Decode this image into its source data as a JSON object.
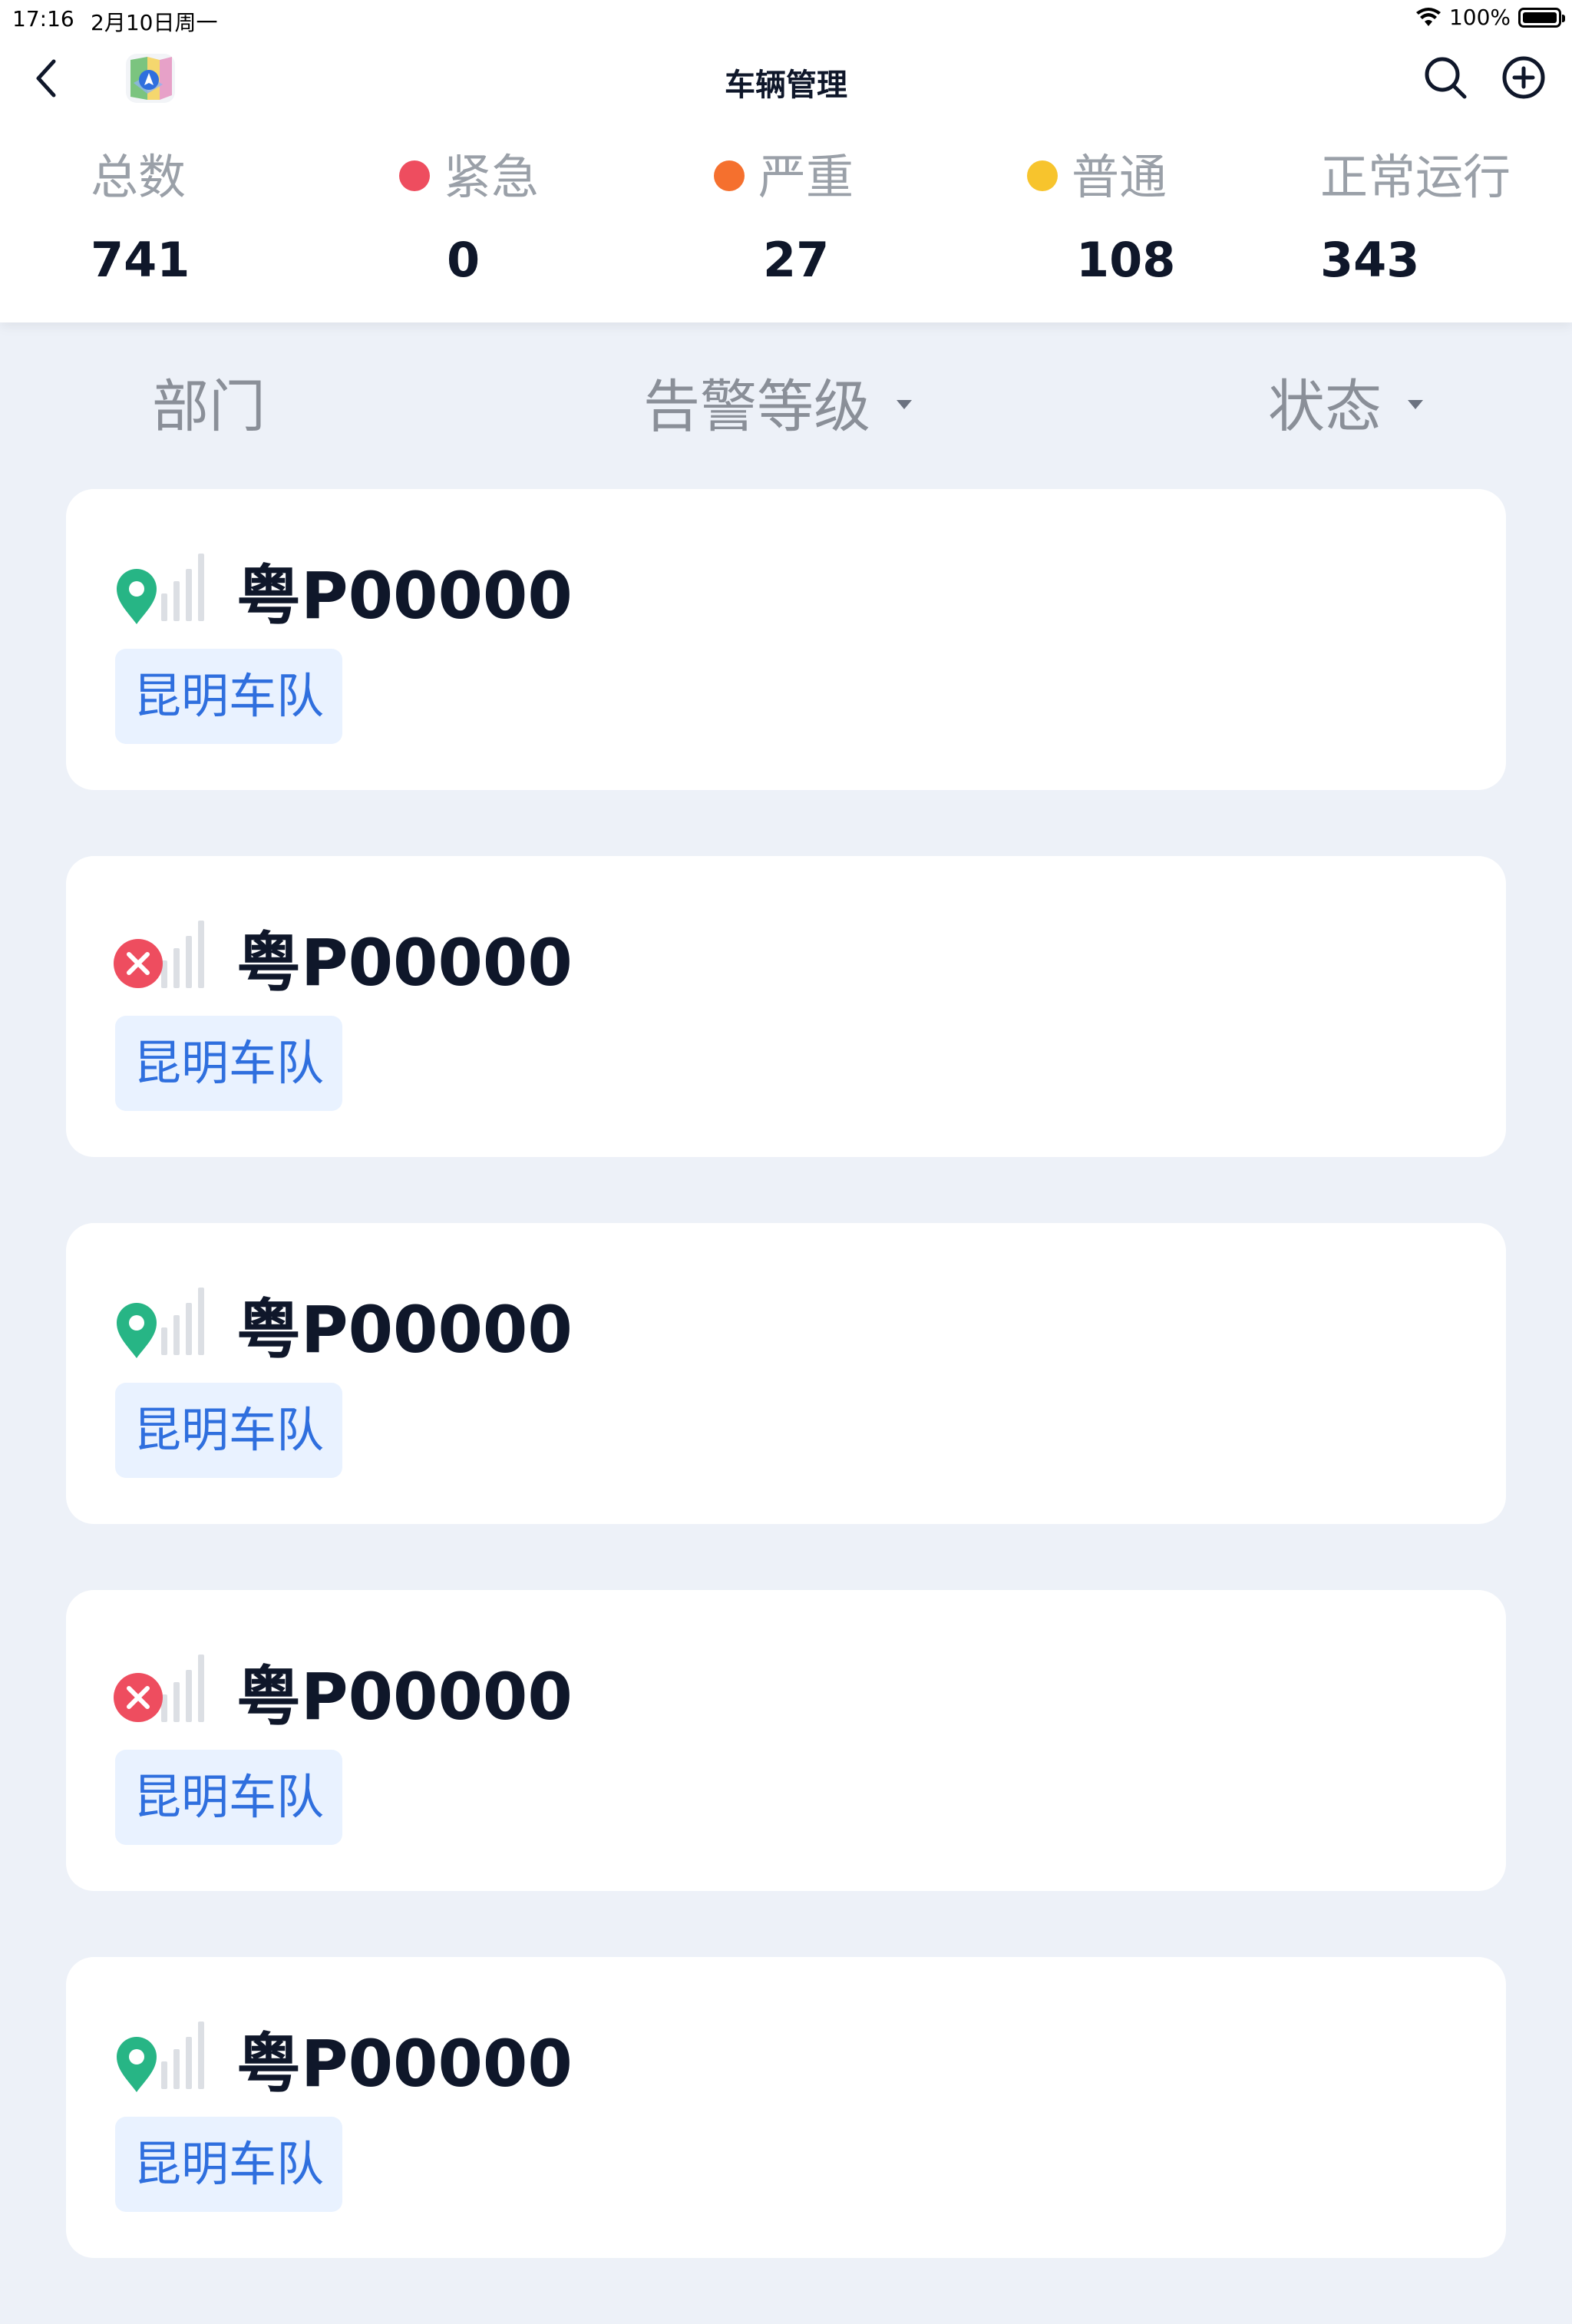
{
  "status_bar": {
    "time": "17:16",
    "date": "2月10日周一",
    "battery": "100%"
  },
  "nav": {
    "title": "车辆管理",
    "back_icon": "chevron-left-icon",
    "search_icon": "search-icon",
    "add_icon": "plus-circle-icon"
  },
  "summary": [
    {
      "label": "总数",
      "value": "741",
      "dot": ""
    },
    {
      "label": "紧急",
      "value": "0",
      "dot": "#ee4d5f"
    },
    {
      "label": "严重",
      "value": "27",
      "dot": "#f5702e"
    },
    {
      "label": "普通",
      "value": "108",
      "dot": "#f7c42d"
    },
    {
      "label": "正常运行",
      "value": "343",
      "dot": ""
    }
  ],
  "filters": [
    {
      "label": "部门",
      "has_dropdown": false
    },
    {
      "label": "告警等级",
      "has_dropdown": true
    },
    {
      "label": "状态",
      "has_dropdown": true
    }
  ],
  "vehicles": [
    {
      "plate": "粤P00000",
      "team": "昆明车队",
      "status": "online"
    },
    {
      "plate": "粤P00000",
      "team": "昆明车队",
      "status": "offline"
    },
    {
      "plate": "粤P00000",
      "team": "昆明车队",
      "status": "online"
    },
    {
      "plate": "粤P00000",
      "team": "昆明车队",
      "status": "offline"
    },
    {
      "plate": "粤P00000",
      "team": "昆明车队",
      "status": "online"
    }
  ],
  "colors": {
    "online": "#27b585",
    "offline": "#ee4d5f",
    "accent": "#2f6fde"
  }
}
